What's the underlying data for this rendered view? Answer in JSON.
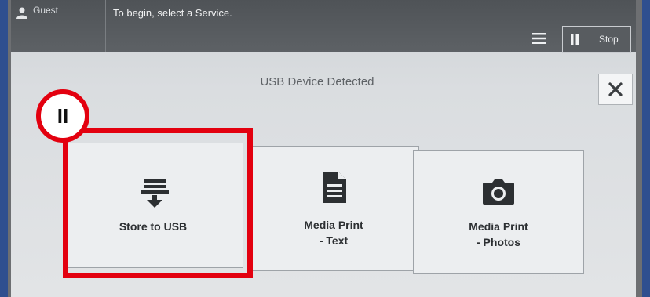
{
  "status_bar": {
    "user": "Guest",
    "instruction": "To begin, select a Service.",
    "stop_label": "Stop"
  },
  "dialog": {
    "title": "USB Device Detected"
  },
  "tiles": [
    {
      "label": "Store to USB",
      "icon": "store-to-usb-icon"
    },
    {
      "label": "Media Print\n- Text",
      "icon": "document-icon"
    },
    {
      "label": "Media Print\n- Photos",
      "icon": "camera-icon"
    }
  ],
  "annotation": {
    "step_label": "II",
    "color": "#e3000f"
  }
}
